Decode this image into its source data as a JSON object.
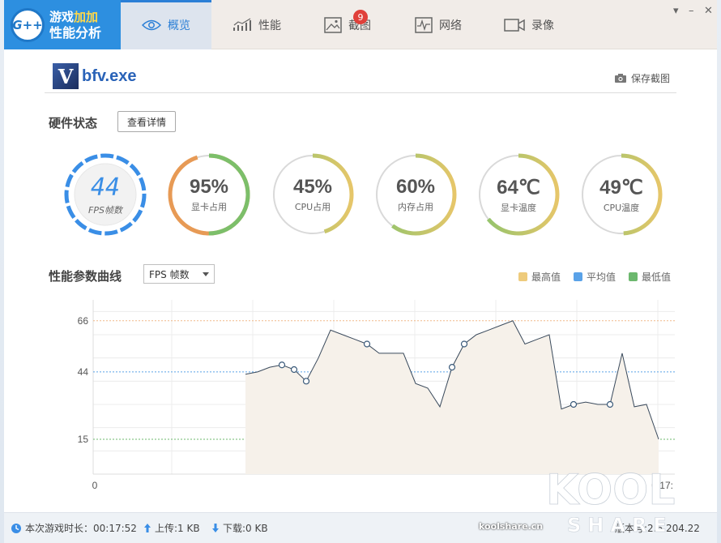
{
  "app": {
    "logo_mark": "G++",
    "title_line1_a": "游戏",
    "title_line1_b": "加加",
    "title_line2": "性能分析"
  },
  "tabs": [
    {
      "label": "概览",
      "icon": "eye-icon",
      "active": true
    },
    {
      "label": "性能",
      "icon": "bar-chart-icon",
      "active": false
    },
    {
      "label": "截图",
      "icon": "picture-icon",
      "active": false,
      "badge": "9"
    },
    {
      "label": "网络",
      "icon": "pulse-icon",
      "active": false
    },
    {
      "label": "录像",
      "icon": "video-icon",
      "active": false
    }
  ],
  "window_controls": {
    "menu": "▾",
    "minimize": "–",
    "close": "✕"
  },
  "process": {
    "icon_letter": "V",
    "name": "bfv.exe"
  },
  "save_screenshot_label": "保存截图",
  "hardware": {
    "title": "硬件状态",
    "detail_button": "查看详情",
    "gauges": [
      {
        "value": "44",
        "label": "FPS帧数",
        "fraction": 1.0,
        "color": "#3a8ee6"
      },
      {
        "value": "95%",
        "label": "显卡占用",
        "fraction": 0.95,
        "color": "#7cbf6a"
      },
      {
        "value": "45%",
        "label": "CPU占用",
        "fraction": 0.45,
        "color": "#8cc46c"
      },
      {
        "value": "60%",
        "label": "内存占用",
        "fraction": 0.6,
        "color": "#8cc46c"
      },
      {
        "value": "64℃",
        "label": "显卡温度",
        "fraction": 0.64,
        "color": "#8cc46c"
      },
      {
        "value": "49℃",
        "label": "CPU温度",
        "fraction": 0.49,
        "color": "#8cc46c"
      }
    ]
  },
  "curve": {
    "title": "性能参数曲线",
    "selected_metric": "FPS 帧数",
    "legend": [
      {
        "label": "最高值",
        "color": "#eecb7c"
      },
      {
        "label": "平均值",
        "color": "#5aa2e8"
      },
      {
        "label": "最低值",
        "color": "#6cb86e"
      }
    ]
  },
  "chart_data": {
    "type": "area",
    "yticks": [
      15,
      44,
      66
    ],
    "ylim": [
      0,
      75
    ],
    "x_start_label": "0",
    "x_end_label": "0:17:",
    "max_line": 66,
    "avg_line": 44,
    "min_line": 15,
    "values": [
      43,
      44,
      46,
      47,
      45,
      40,
      50,
      62,
      60,
      58,
      56,
      52,
      52,
      52,
      39,
      37,
      29,
      46,
      56,
      60,
      62,
      64,
      66,
      56,
      58,
      60,
      28,
      30,
      31,
      30,
      30,
      52,
      29,
      30,
      15
    ],
    "markers": [
      3,
      4,
      5,
      10,
      17,
      18,
      27,
      30
    ]
  },
  "status": {
    "playtime_label": "本次游戏时长：",
    "playtime_value": "00:17:52",
    "upload_label": "上传: ",
    "upload_value": "1 KB",
    "download_label": "下载: ",
    "download_value": "0 KB",
    "version_label": "版本号: ",
    "version_value": "2.6.204.22"
  },
  "watermark": {
    "brand": "KOOL",
    "sub": "SHARE",
    "site": "koolshare.cn"
  }
}
